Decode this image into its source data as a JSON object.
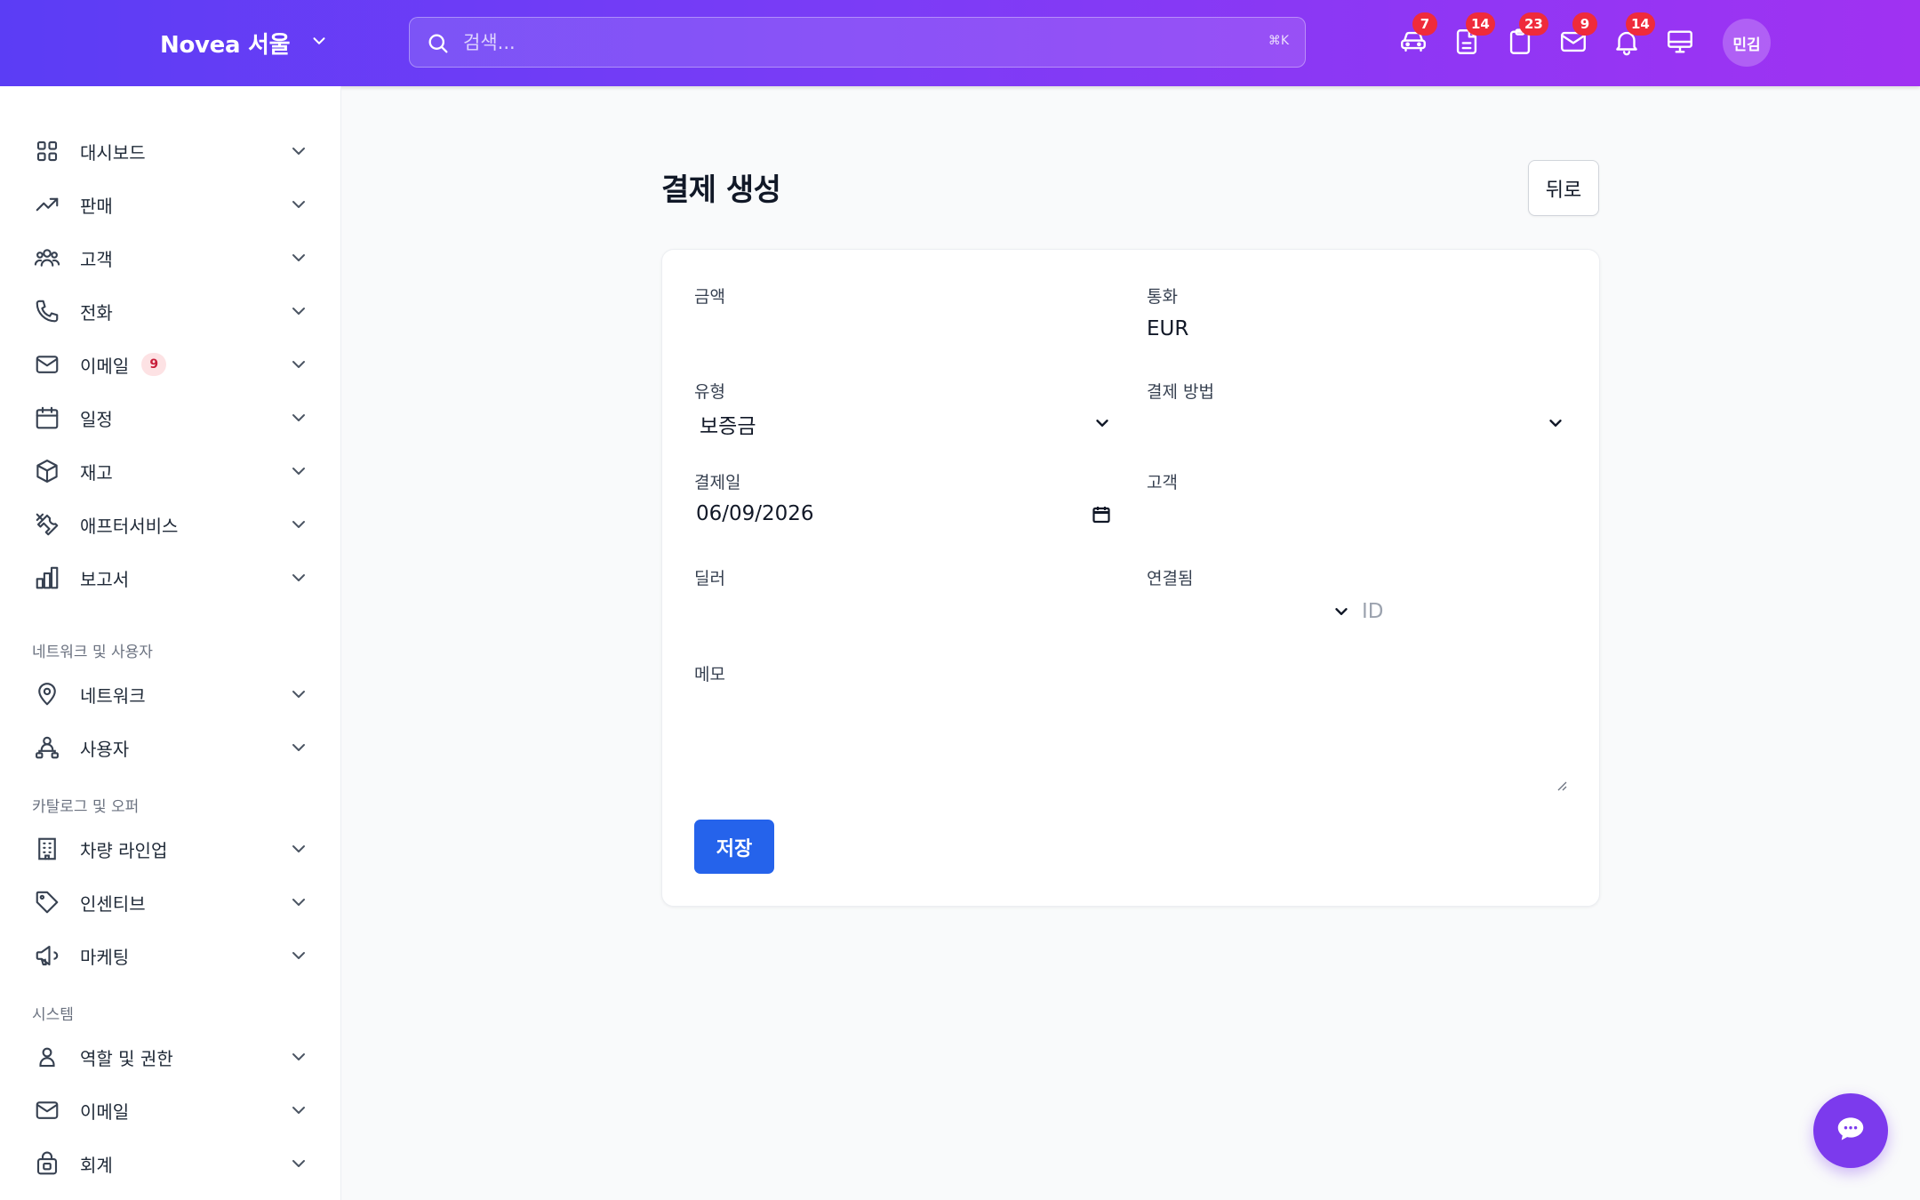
{
  "header": {
    "brand": "Novea 서울",
    "search_placeholder": "검색...",
    "search_shortcut": "⌘K",
    "icons": [
      {
        "name": "car-icon",
        "badge": "7"
      },
      {
        "name": "document-icon",
        "badge": "14"
      },
      {
        "name": "clipboard-icon",
        "badge": "23"
      },
      {
        "name": "mail-icon",
        "badge": "9"
      },
      {
        "name": "bell-icon",
        "badge": "14"
      },
      {
        "name": "monitor-icon",
        "badge": ""
      }
    ],
    "avatar": "민김",
    "accent": "#6d3cf6"
  },
  "sidebar": {
    "items": [
      {
        "label": "대시보드",
        "icon": "grid-icon"
      },
      {
        "label": "판매",
        "icon": "trending-up-icon"
      },
      {
        "label": "고객",
        "icon": "users-icon"
      },
      {
        "label": "전화",
        "icon": "phone-icon"
      },
      {
        "label": "이메일",
        "icon": "mail-icon",
        "count": "9"
      },
      {
        "label": "일정",
        "icon": "calendar-icon"
      },
      {
        "label": "재고",
        "icon": "box-icon"
      },
      {
        "label": "애프터서비스",
        "icon": "tools-icon"
      },
      {
        "label": "보고서",
        "icon": "bar-chart-icon"
      }
    ],
    "sections": [
      {
        "title": "네트워크 및 사용자",
        "items": [
          {
            "label": "네트워크",
            "icon": "map-pin-icon"
          },
          {
            "label": "사용자",
            "icon": "user-network-icon"
          }
        ]
      },
      {
        "title": "카탈로그 및 오퍼",
        "items": [
          {
            "label": "차량 라인업",
            "icon": "building-icon"
          },
          {
            "label": "인센티브",
            "icon": "tag-icon"
          },
          {
            "label": "마케팅",
            "icon": "megaphone-icon"
          }
        ]
      },
      {
        "title": "시스템",
        "items": [
          {
            "label": "역할 및 권한",
            "icon": "user-icon"
          },
          {
            "label": "이메일",
            "icon": "mail-icon"
          },
          {
            "label": "회계",
            "icon": "bag-icon"
          }
        ]
      }
    ]
  },
  "main": {
    "title": "결제 생성",
    "back_label": "뒤로",
    "form": {
      "amount_label": "금액",
      "amount_value": "",
      "currency_label": "통화",
      "currency_value": "EUR",
      "type_label": "유형",
      "type_value": "보증금",
      "method_label": "결제 방법",
      "method_value": "",
      "date_label": "결제일",
      "date_value": "06/09/2026",
      "customer_label": "고객",
      "customer_value": "",
      "dealer_label": "딜러",
      "dealer_value": "",
      "linked_label": "연결됨",
      "linked_id_placeholder": "ID",
      "memo_label": "메모",
      "memo_value": "",
      "save_label": "저장",
      "save_color": "#2563eb"
    }
  },
  "chat": {
    "icon": "chat-icon",
    "color": "#7c3aed"
  }
}
